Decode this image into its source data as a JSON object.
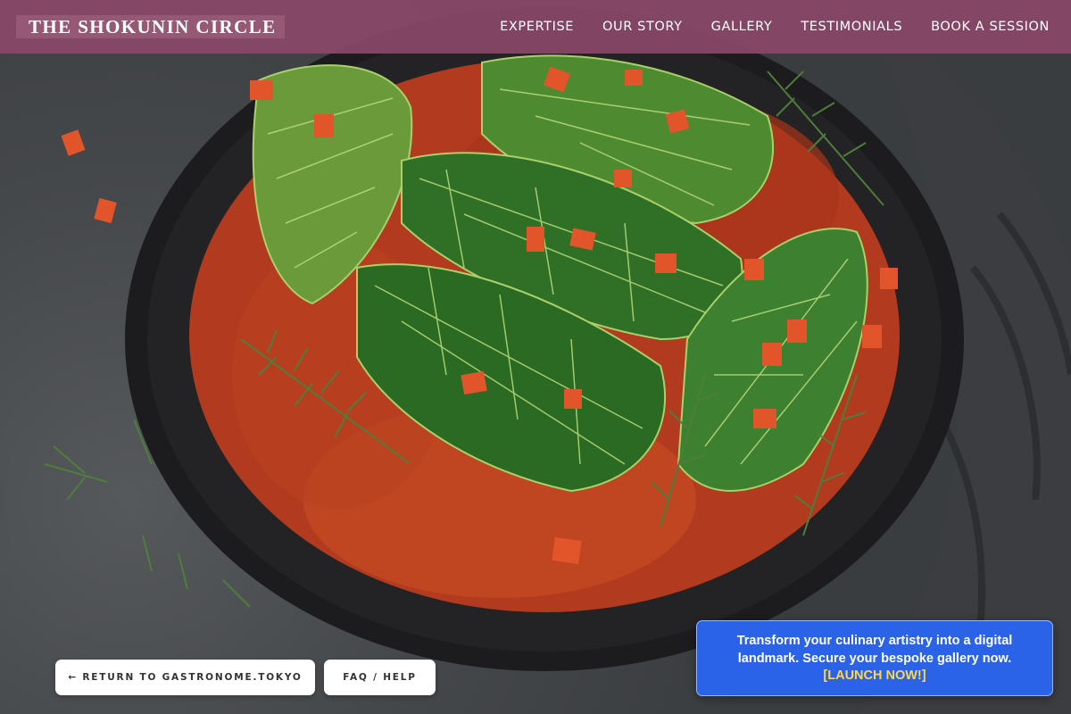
{
  "header": {
    "brand": "THE SHOKUNIN CIRCLE",
    "nav": [
      "EXPERTISE",
      "OUR STORY",
      "GALLERY",
      "TESTIMONIALS",
      "BOOK A SESSION"
    ]
  },
  "hero": {
    "image_description_icon": "skillet-cabbage-rolls-photo"
  },
  "footer_buttons": {
    "return_label": "← RETURN TO GASTRONOME.TOKYO",
    "faq_label": "FAQ / HELP"
  },
  "promo": {
    "message": "Transform your culinary artistry into a digital landmark. Secure your bespoke gallery now.",
    "cta": "[LAUNCH NOW!]"
  },
  "colors": {
    "header_bg": "#8a4868",
    "promo_bg": "#2a63e8",
    "cta_text": "#ffd84a"
  }
}
